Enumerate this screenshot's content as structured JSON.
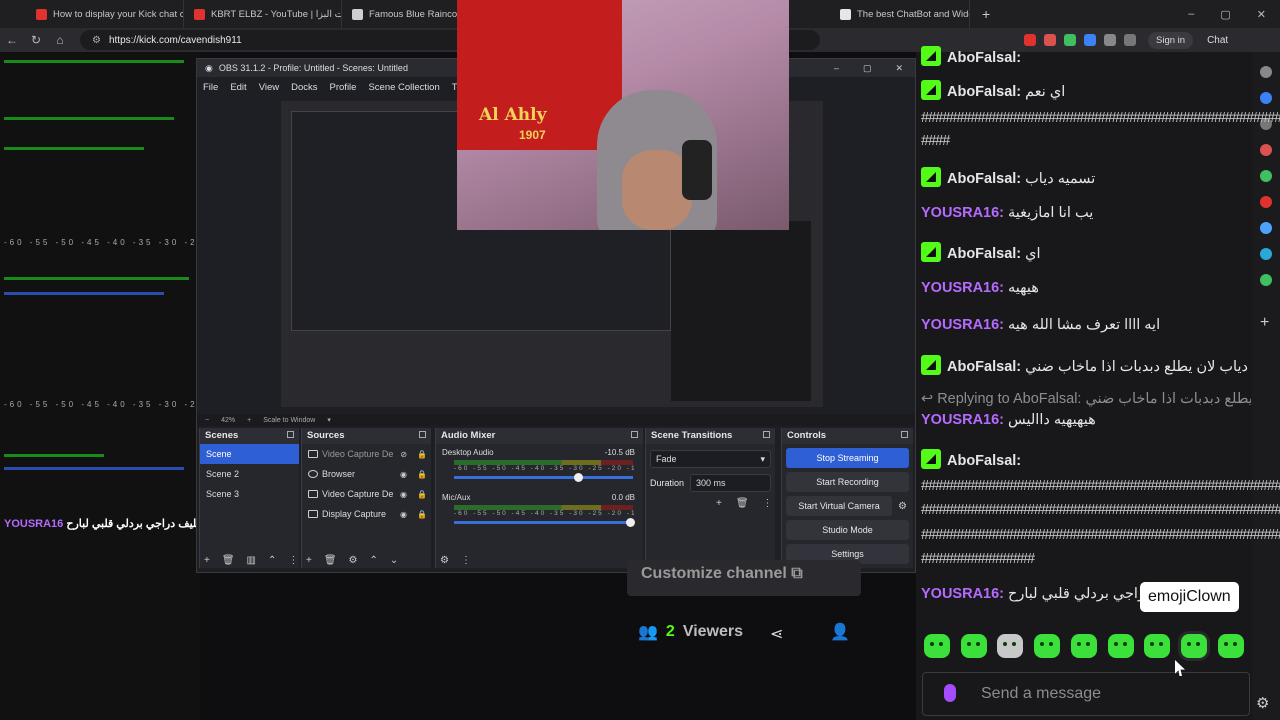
{
  "browser": {
    "tabs": [
      {
        "title": "How to display your Kick chat on ..",
        "color": "#e0332f"
      },
      {
        "title": "KBRT ELBZ - YouTube | كبرت البزا",
        "color": "#e0332f"
      },
      {
        "title": "Famous Blue Raincoat Bag",
        "color": "#cfcfcf"
      },
      {
        "title": "The best ChatBot and Widgets for",
        "color": "#e6e6e6"
      }
    ],
    "url": "https://kick.com/cavendish911",
    "sign_in": "Sign in",
    "chat_label": "Chat"
  },
  "left_pane": {
    "ticks": "-60 -55 -50 -45 -40 -35 -30 -25",
    "chat_user": "YOUSRA16",
    "chat_text": "اييه حليف دراجي بردلي قلبي لبارح :"
  },
  "obs": {
    "title": "OBS 31.1.2 - Profile: Untitled - Scenes: Untitled",
    "menu": [
      "File",
      "Edit",
      "View",
      "Docks",
      "Profile",
      "Scene Collection",
      "Tools"
    ],
    "zoom": "42%",
    "scale": "Scale to Window",
    "docks": {
      "scenes": {
        "title": "Scenes",
        "items": [
          "Scene",
          "Scene 2",
          "Scene 3"
        ]
      },
      "sources": {
        "title": "Sources",
        "items": [
          "Video Capture De",
          "Browser",
          "Video Capture De",
          "Display Capture"
        ]
      },
      "mixer": {
        "title": "Audio Mixer",
        "channels": [
          {
            "name": "Desktop Audio",
            "level": "-10.5 dB"
          },
          {
            "name": "Mic/Aux",
            "level": "0.0 dB"
          }
        ],
        "ticks": "-60 -55 -50 -45 -40 -35 -30 -25 -20 -15 -10 -5 0"
      },
      "transitions": {
        "title": "Scene Transitions",
        "transition": "Fade",
        "duration_label": "Duration",
        "duration": "300 ms"
      },
      "controls": {
        "title": "Controls",
        "buttons": [
          "Stop Streaming",
          "Start Recording",
          "Start Virtual Camera",
          "Studio Mode",
          "Settings"
        ]
      }
    }
  },
  "webcam": {
    "flag_text": "Al Ahly",
    "flag_year": "1907"
  },
  "chat": {
    "messages": [
      {
        "user": "AboFalsal:",
        "text": "",
        "badge": true
      },
      {
        "user": "AboFalsal:",
        "text": "اي نعم",
        "badge": true
      },
      {
        "dots": "####################################################"
      },
      {
        "dots": "####"
      },
      {
        "user": "AboFalsal:",
        "text": "تسميه دياب",
        "badge": true
      },
      {
        "user": "YOUSRA16:",
        "text": "يب انا امازيغية",
        "badge": false
      },
      {
        "user": "AboFalsal:",
        "text": "اي",
        "badge": true
      },
      {
        "user": "YOUSRA16:",
        "text": "هيهيه",
        "badge": false
      },
      {
        "user": "YOUSRA16:",
        "text": "ايه اااا تعرف مشا الله هيه",
        "badge": false
      },
      {
        "user": "AboFalsal:",
        "text": "يه دياب لان يطلع دبدبات اذا ماخاب ضني",
        "badge": true
      },
      {
        "reply": "Replying to AboFalsal: لان يطلع دبدبات اذا ماخاب ضني"
      },
      {
        "user": "YOUSRA16:",
        "text": "هيهيهيه دااليس",
        "badge": false
      },
      {
        "user": "AboFalsal:",
        "text": "",
        "badge": true
      },
      {
        "dots": "####################################################"
      },
      {
        "dots": "####################################################"
      },
      {
        "dots": "####################################################"
      },
      {
        "dots": "################"
      },
      {
        "user": "YOUSRA16:",
        "text": "دراجي بردلي قلبي لبارح",
        "badge": false
      }
    ],
    "tooltip": "emojiClown",
    "send_placeholder": "Send a message",
    "customize": "Customize channel",
    "viewers_count": "2",
    "viewers_label": "Viewers"
  }
}
